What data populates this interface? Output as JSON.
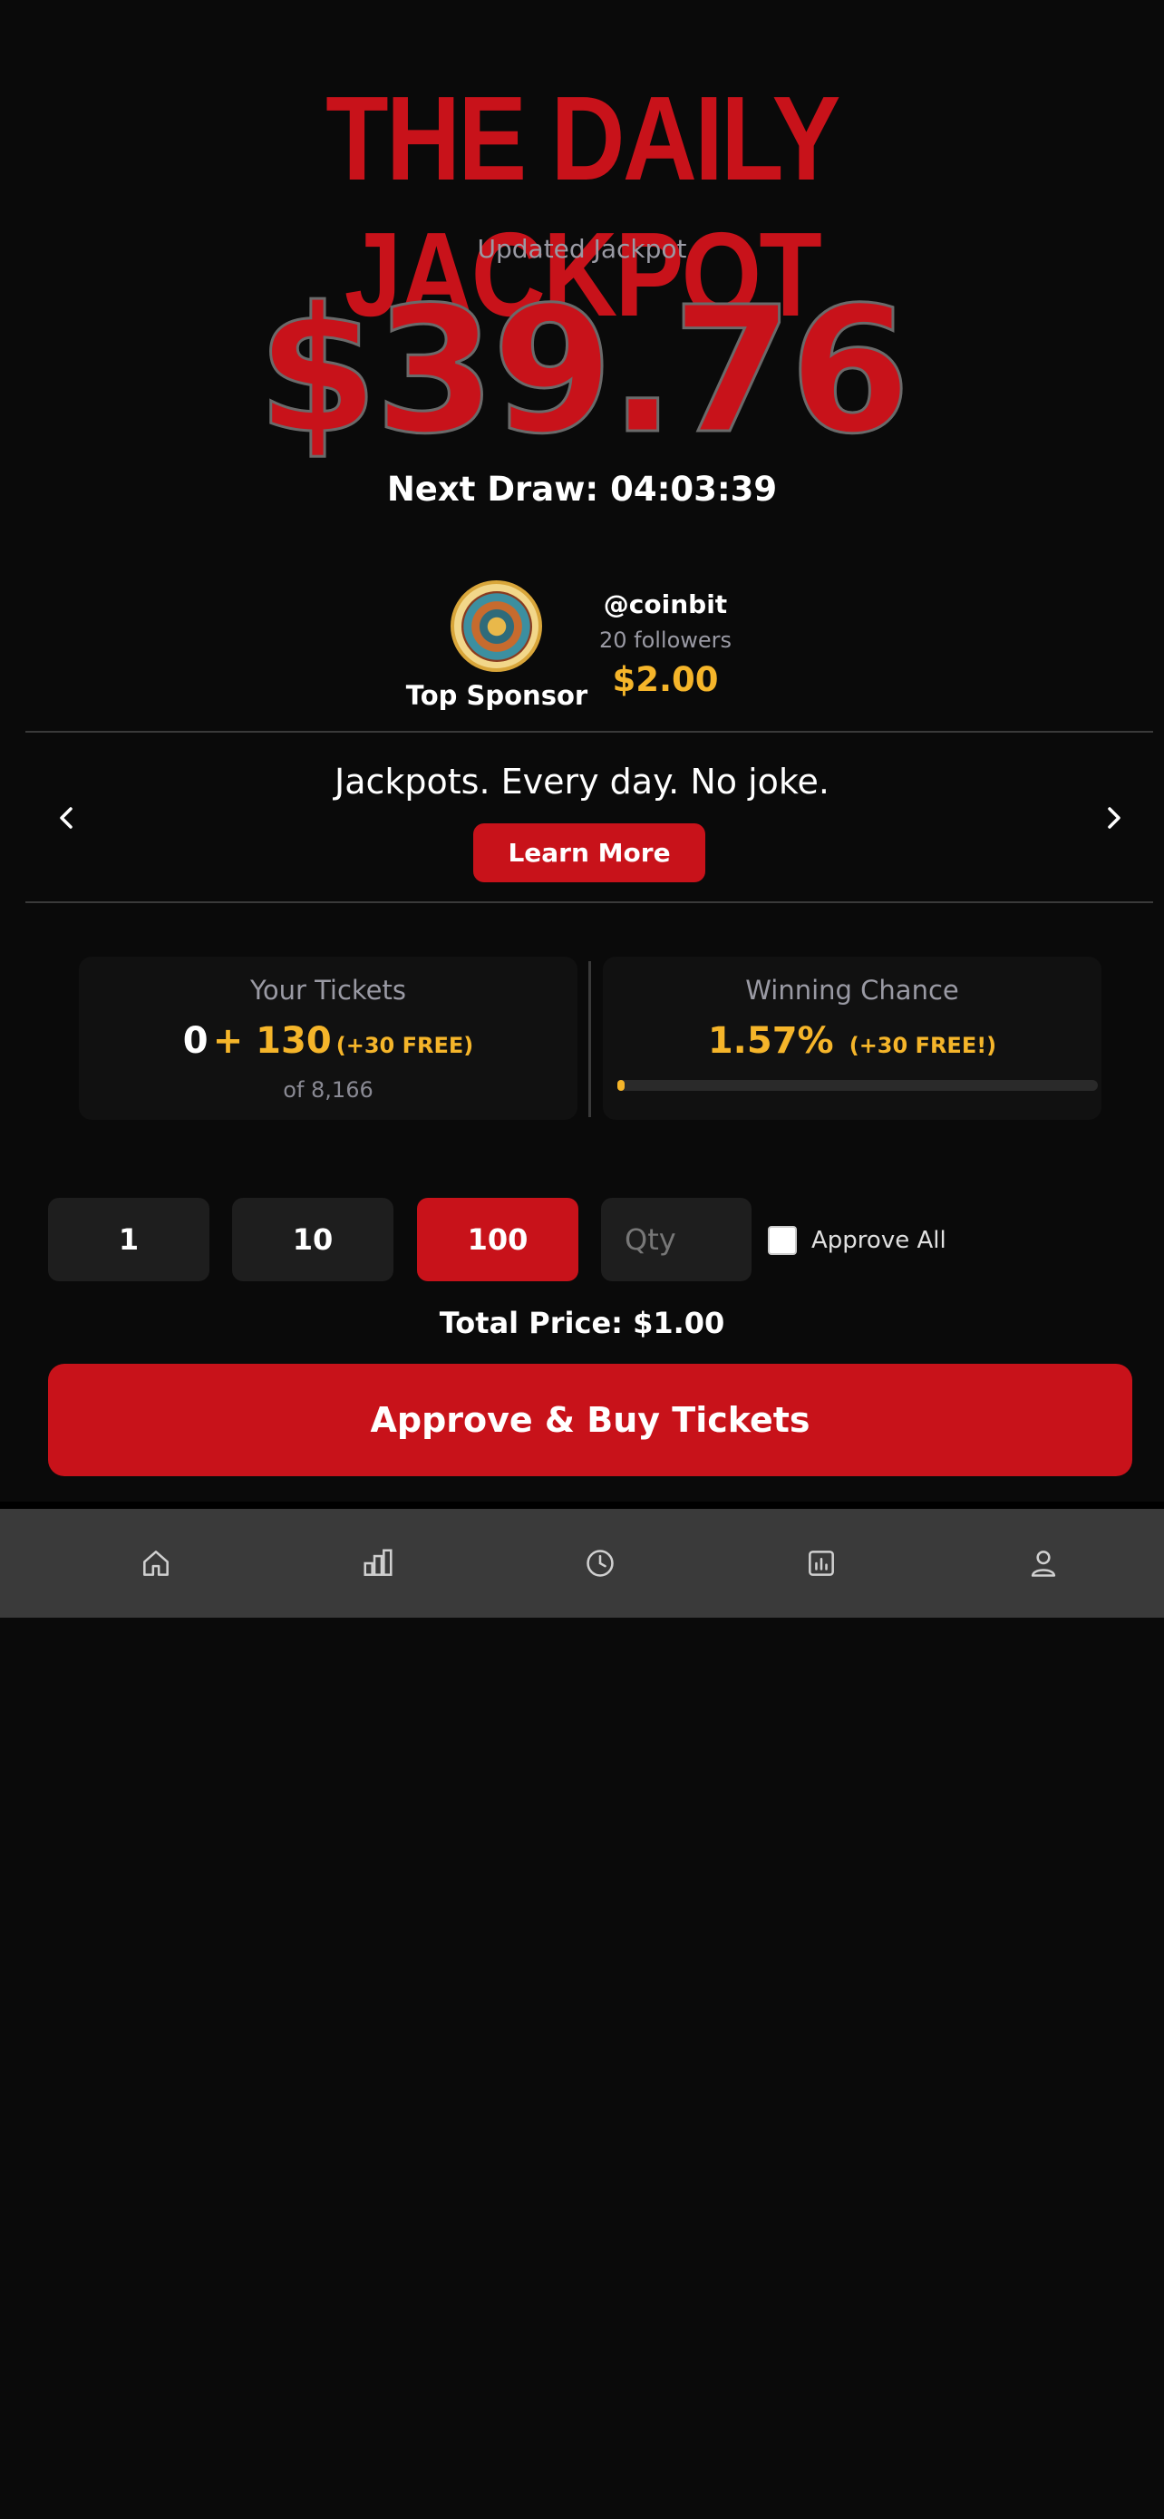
{
  "header": {
    "title": "THE DAILY JACKPOT",
    "jackpot_label": "Updated Jackpot",
    "jackpot_amount": "$39.76",
    "next_draw": "Next Draw: 04:03:39"
  },
  "sponsor": {
    "role": "Top Sponsor",
    "handle": "@coinbit",
    "followers": "20 followers",
    "amount": "$2.00",
    "avatar_icon": "coin-emblem-icon"
  },
  "banner": {
    "text": "Jackpots. Every day. No joke.",
    "button_label": "Learn More",
    "prev_icon": "chevron-left-icon",
    "next_icon": "chevron-right-icon"
  },
  "stats": {
    "tickets_title": "Your Tickets",
    "tickets_own": "0",
    "tickets_plus": "+ 130",
    "tickets_free": "(+30 FREE)",
    "tickets_of": "of 8,166",
    "chance_title": "Winning Chance",
    "chance_value": "1.57%",
    "chance_free": "(+30 FREE!)",
    "chance_progress_percent": 1.57
  },
  "purchase": {
    "qty_options": [
      "1",
      "10",
      "100"
    ],
    "selected_qty": "100",
    "qty_placeholder": "Qty",
    "approve_all_label": "Approve All",
    "total_price": "Total Price: $1.00",
    "buy_label": "Approve & Buy Tickets"
  },
  "bottom_nav": {
    "items": [
      "home-icon",
      "leaderboard-icon",
      "history-icon",
      "stats-icon",
      "profile-icon"
    ]
  },
  "colors": {
    "accent_red": "#c8121a",
    "accent_gold": "#f5b52a",
    "background": "#0a0a0a",
    "nav_background": "#3a3a3a"
  }
}
